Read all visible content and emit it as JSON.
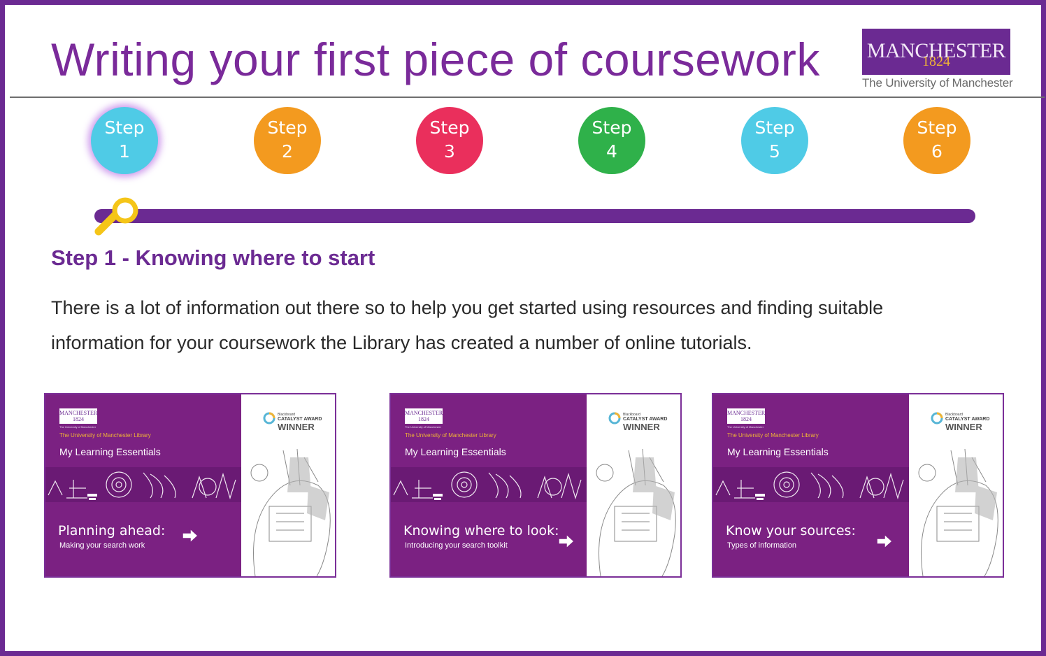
{
  "header": {
    "title": "Writing your first piece of coursework",
    "logo": {
      "name": "MANCHESTER",
      "year": "1824",
      "tagline": "The University of Manchester"
    }
  },
  "steps": [
    {
      "label": "Step",
      "number": "1",
      "color": "#4fcbe6",
      "active": true
    },
    {
      "label": "Step",
      "number": "2",
      "color": "#f39a1f",
      "active": false
    },
    {
      "label": "Step",
      "number": "3",
      "color": "#ea2f5c",
      "active": false
    },
    {
      "label": "Step",
      "number": "4",
      "color": "#2fb14a",
      "active": false
    },
    {
      "label": "Step",
      "number": "5",
      "color": "#4fcbe6",
      "active": false
    },
    {
      "label": "Step",
      "number": "6",
      "color": "#f39a1f",
      "active": false
    }
  ],
  "progress": {
    "current_step": 1,
    "total_steps": 6,
    "marker_icon": "magnifier-icon",
    "marker_color": "#f5c518"
  },
  "section": {
    "heading": "Step 1 - Knowing where to start",
    "body": "There is a lot of information out there so to help you get started using resources and finding suitable information for your coursework the Library has created a number of online tutorials."
  },
  "tutorials": [
    {
      "library": "The University of Manchester Library",
      "series": "My Learning Essentials",
      "title": "Planning ahead:",
      "subtitle": "Making your search work",
      "award": {
        "small": "Blackboard",
        "mid": "CATALYST AWARD",
        "big": "WINNER"
      },
      "logo": "MANCHESTER\n1824",
      "logo_sub": "The University of Manchester"
    },
    {
      "library": "The University of Manchester Library",
      "series": "My Learning Essentials",
      "title": "Knowing where to look:",
      "subtitle": "Introducing your search toolkit",
      "award": {
        "small": "Blackboard",
        "mid": "CATALYST AWARD",
        "big": "WINNER"
      },
      "logo": "MANCHESTER\n1824",
      "logo_sub": "The University of Manchester"
    },
    {
      "library": "The University of Manchester Library",
      "series": "My Learning Essentials",
      "title": "Know your sources:",
      "subtitle": "Types of information",
      "award": {
        "small": "Blackboard",
        "mid": "CATALYST AWARD",
        "big": "WINNER"
      },
      "logo": "MANCHESTER\n1824",
      "logo_sub": "The University of Manchester"
    }
  ],
  "colors": {
    "brand_purple": "#6b2a92",
    "card_purple": "#7b2182",
    "accent_gold": "#f0b435"
  }
}
